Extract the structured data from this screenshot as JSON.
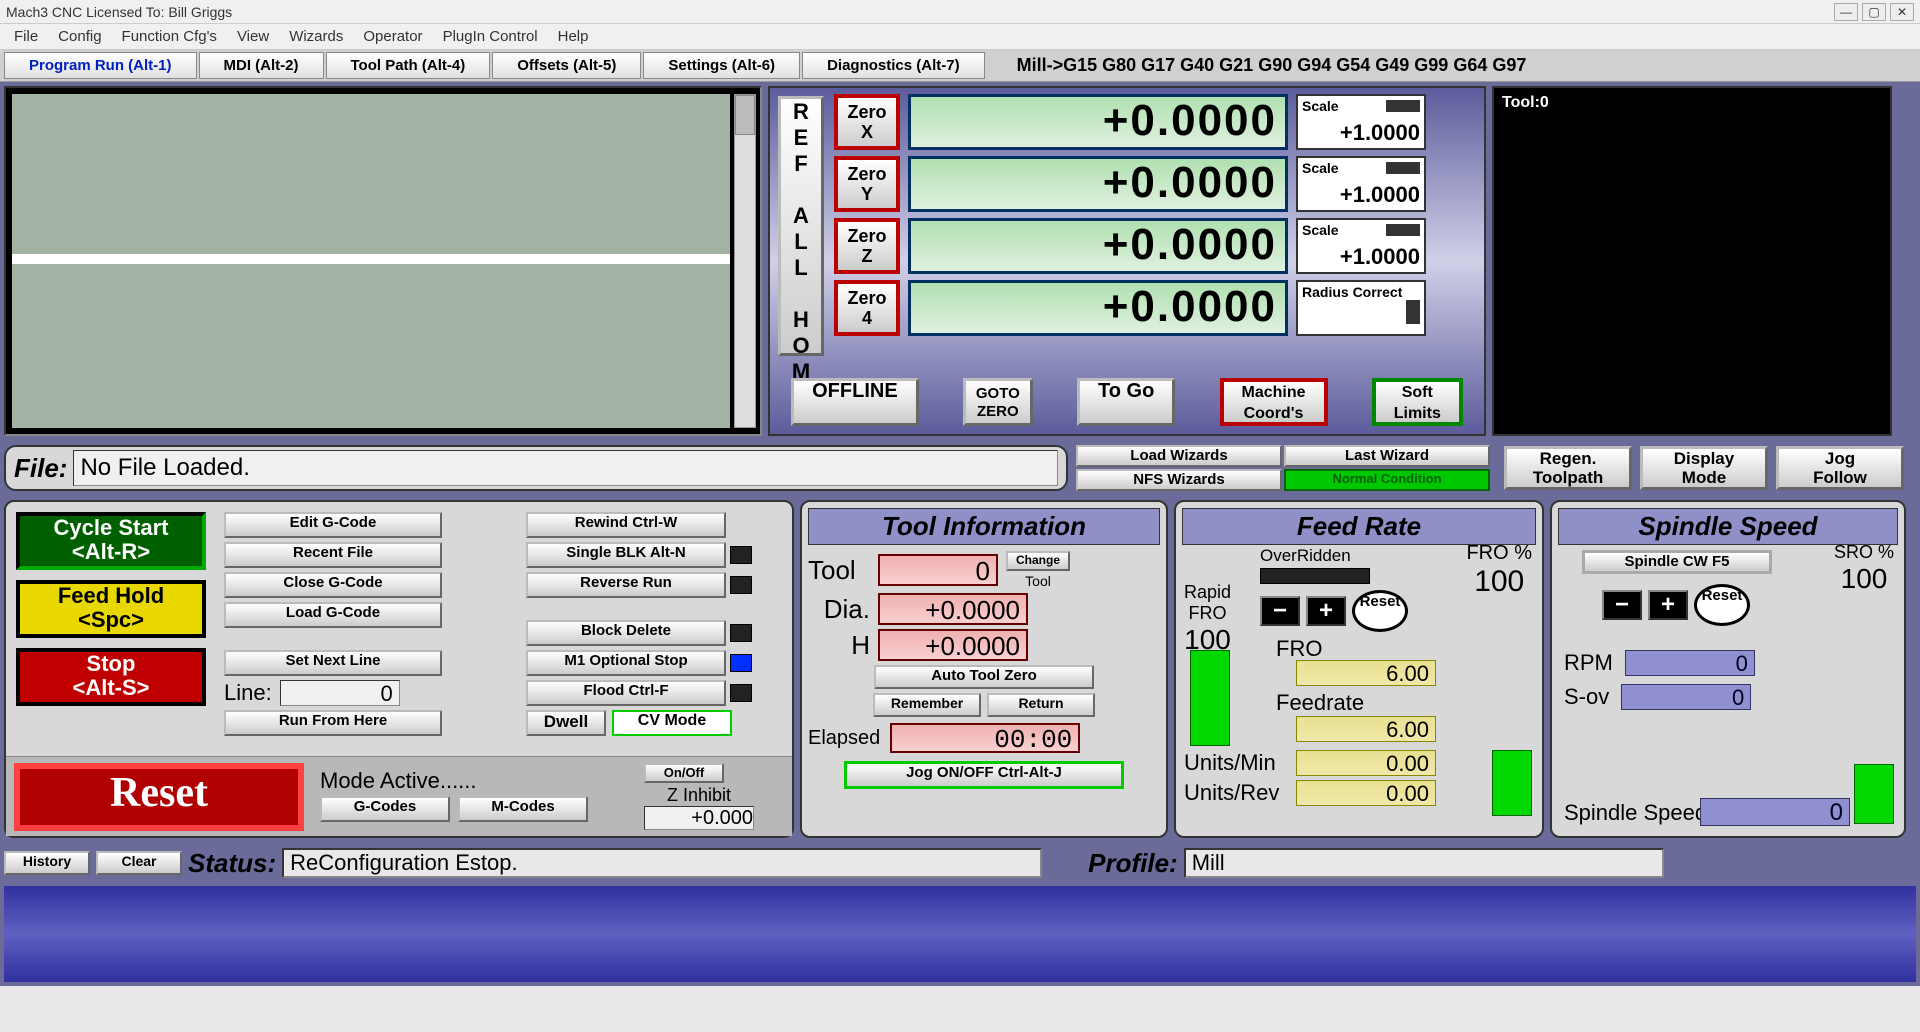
{
  "window": {
    "title": "Mach3 CNC  Licensed To: Bill Griggs"
  },
  "menu": {
    "file": "File",
    "config": "Config",
    "funccfg": "Function Cfg's",
    "view": "View",
    "wizards": "Wizards",
    "operator": "Operator",
    "plugin": "PlugIn Control",
    "help": "Help"
  },
  "tabs": {
    "run": "Program Run (Alt-1)",
    "mdi": "MDI (Alt-2)",
    "toolpath": "Tool Path (Alt-4)",
    "offsets": "Offsets (Alt-5)",
    "settings": "Settings (Alt-6)",
    "diag": "Diagnostics (Alt-7)"
  },
  "gstrip": "Mill->G15  G80 G17 G40 G21 G90 G94 G54 G49 G99 G64 G97",
  "ref": "REF ALL HOME",
  "axes": {
    "x": {
      "zero": "Zero X",
      "dro": "+0.0000",
      "scale": "Scale",
      "sval": "+1.0000"
    },
    "y": {
      "zero": "Zero Y",
      "dro": "+0.0000",
      "scale": "Scale",
      "sval": "+1.0000"
    },
    "z": {
      "zero": "Zero Z",
      "dro": "+0.0000",
      "scale": "Scale",
      "sval": "+1.0000"
    },
    "a": {
      "zero": "Zero 4",
      "dro": "+0.0000",
      "radius": "Radius Correct"
    }
  },
  "drobtns": {
    "offline": "OFFLINE",
    "gotozero": "GOTO ZERO",
    "togo": "To Go",
    "mc": "Machine Coord's",
    "soft": "Soft Limits"
  },
  "toolpath": {
    "label": "Tool:0"
  },
  "file": {
    "label": "File:",
    "value": "No File Loaded."
  },
  "wiz": {
    "load": "Load Wizards",
    "last": "Last Wizard",
    "nfs": "NFS Wizards",
    "norm": "Normal Condition"
  },
  "rtb": {
    "regen": "Regen. Toolpath",
    "disp": "Display Mode",
    "jog": "Jog Follow"
  },
  "ctrl": {
    "cycle": "Cycle Start <Alt-R>",
    "hold": "Feed Hold <Spc>",
    "stop": "Stop <Alt-S>",
    "edit": "Edit G-Code",
    "recent": "Recent File",
    "close": "Close G-Code",
    "loadg": "Load G-Code",
    "setnext": "Set Next Line",
    "line": "Line:",
    "lineval": "0",
    "runfrom": "Run From Here",
    "rewind": "Rewind Ctrl-W",
    "single": "Single BLK Alt-N",
    "reverse": "Reverse Run",
    "blockdel": "Block Delete",
    "m1": "M1 Optional Stop",
    "flood": "Flood Ctrl-F",
    "dwell": "Dwell",
    "cv": "CV Mode",
    "onoff": "On/Off",
    "zinh": "Z Inhibit",
    "zval": "+0.000",
    "reset": "Reset",
    "mode": "Mode Active......",
    "gcodes": "G-Codes",
    "mcodes": "M-Codes"
  },
  "tool": {
    "hdr": "Tool Information",
    "tool": "Tool",
    "tval": "0",
    "change": "Change",
    "toollbl": "Tool",
    "dia": "Dia.",
    "dval": "+0.0000",
    "h": "H",
    "hval": "+0.0000",
    "atz": "Auto Tool Zero",
    "rem": "Remember",
    "ret": "Return",
    "elapsed": "Elapsed",
    "etime": "00:00",
    "jog": "Jog ON/OFF Ctrl-Alt-J"
  },
  "feed": {
    "hdr": "Feed Rate",
    "over": "OverRidden",
    "fropct": "FRO %",
    "fro100": "100",
    "rapid": "Rapid FRO",
    "r100": "100",
    "fro": "FRO",
    "froval": "6.00",
    "frate": "Feedrate",
    "frval": "6.00",
    "umin": "Units/Min",
    "uminv": "0.00",
    "urev": "Units/Rev",
    "urevv": "0.00",
    "reset": "Reset"
  },
  "spindle": {
    "hdr": "Spindle Speed",
    "cw": "Spindle CW F5",
    "sro": "SRO %",
    "s100": "100",
    "reset": "Reset",
    "rpm": "RPM",
    "rpmv": "0",
    "sov": "S-ov",
    "sovv": "0",
    "ss": "Spindle Speed",
    "ssv": "0"
  },
  "status": {
    "hist": "History",
    "clear": "Clear",
    "label": "Status:",
    "value": "ReConfiguration Estop.",
    "profile": "Profile:",
    "pval": "Mill"
  }
}
